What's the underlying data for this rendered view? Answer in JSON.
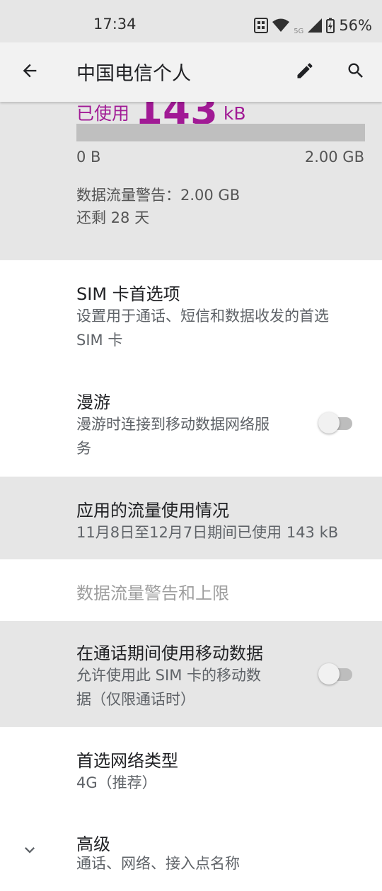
{
  "status_bar": {
    "time": "17:34",
    "network_label": "5G",
    "battery": "56%",
    "icons": [
      "sim-status-icon",
      "wifi-icon",
      "cell-signal-icon",
      "battery-charging-icon"
    ]
  },
  "app_bar": {
    "title": "中国电信个人",
    "back_icon": "arrow-back-icon",
    "edit_icon": "pencil-icon",
    "search_icon": "search-icon"
  },
  "usage": {
    "used_prefix": "已使用",
    "used_value": "143",
    "used_unit": "kB",
    "used_fraction": 0.0,
    "min_label": "0 B",
    "max_label": "2.00 GB",
    "warning_text": "数据流量警告：2.00 GB",
    "remaining_text": "还剩 28 天",
    "accent_color": "#a11a95"
  },
  "settings": {
    "sim_pref": {
      "title": "SIM 卡首选项",
      "summary_line1": "设置用于通话、短信和数据收发的首选",
      "summary_line2": "SIM 卡"
    },
    "roaming": {
      "title": "漫游",
      "summary_line1": "漫游时连接到移动数据网络服",
      "summary_line2": "务",
      "enabled": false
    },
    "app_usage": {
      "title": "应用的流量使用情况",
      "summary": "11月8日至12月7日期间已使用 143 kB"
    },
    "data_warning": {
      "title": "数据流量警告和上限"
    },
    "call_data": {
      "title": "在通话期间使用移动数据",
      "summary_line1": "允许使用此 SIM 卡的移动数",
      "summary_line2": "据（仅限通话时）",
      "enabled": false
    },
    "network_type": {
      "title": "首选网络类型",
      "summary": "4G（推荐）"
    },
    "advanced": {
      "title": "高级",
      "summary": "通话、网络、接入点名称",
      "icon": "chevron-down-icon"
    }
  }
}
